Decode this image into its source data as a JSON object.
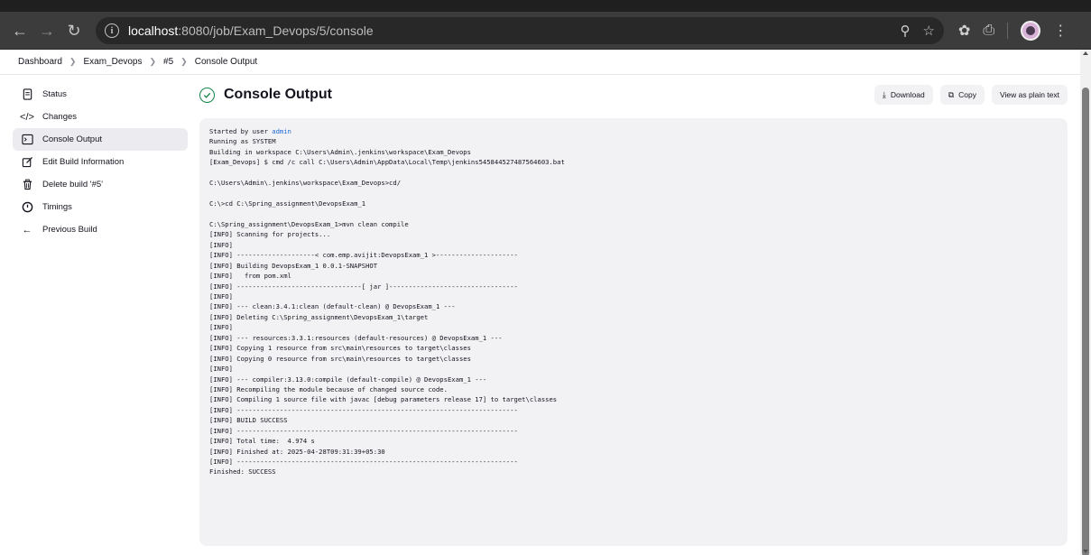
{
  "browser": {
    "url_host": "localhost",
    "url_rest": ":8080/job/Exam_Devops/5/console"
  },
  "breadcrumb": [
    "Dashboard",
    "Exam_Devops",
    "#5",
    "Console Output"
  ],
  "sidebar": {
    "items": [
      {
        "label": "Status",
        "icon": "document-icon",
        "active": false
      },
      {
        "label": "Changes",
        "icon": "code-icon",
        "active": false
      },
      {
        "label": "Console Output",
        "icon": "terminal-icon",
        "active": true
      },
      {
        "label": "Edit Build Information",
        "icon": "edit-icon",
        "active": false
      },
      {
        "label": "Delete build '#5'",
        "icon": "trash-icon",
        "active": false
      },
      {
        "label": "Timings",
        "icon": "clock-icon",
        "active": false
      },
      {
        "label": "Previous Build",
        "icon": "arrow-left-icon",
        "active": false
      }
    ]
  },
  "main": {
    "title": "Console Output",
    "status_color": "#138347",
    "actions": {
      "download": "Download",
      "copy": "Copy",
      "plain": "View as plain text"
    }
  },
  "console": {
    "started_prefix": "Started by user ",
    "started_user": "admin",
    "lines": [
      "Running as SYSTEM",
      "Building in workspace C:\\Users\\Admin\\.jenkins\\workspace\\Exam_Devops",
      "[Exam_Devops] $ cmd /c call C:\\Users\\Admin\\AppData\\Local\\Temp\\jenkins545844527487564603.bat",
      "",
      "C:\\Users\\Admin\\.jenkins\\workspace\\Exam_Devops>cd/",
      "",
      "C:\\>cd C:\\Spring_assignment\\DevopsExam_1",
      "",
      "C:\\Spring_assignment\\DevopsExam_1>mvn clean compile",
      "[INFO] Scanning for projects...",
      "[INFO]",
      "[INFO] --------------------< com.emp.avijit:DevopsExam_1 >---------------------",
      "[INFO] Building DevopsExam_1 0.0.1-SNAPSHOT",
      "[INFO]   from pom.xml",
      "[INFO] --------------------------------[ jar ]---------------------------------",
      "[INFO]",
      "[INFO] --- clean:3.4.1:clean (default-clean) @ DevopsExam_1 ---",
      "[INFO] Deleting C:\\Spring_assignment\\DevopsExam_1\\target",
      "[INFO]",
      "[INFO] --- resources:3.3.1:resources (default-resources) @ DevopsExam_1 ---",
      "[INFO] Copying 1 resource from src\\main\\resources to target\\classes",
      "[INFO] Copying 0 resource from src\\main\\resources to target\\classes",
      "[INFO]",
      "[INFO] --- compiler:3.13.0:compile (default-compile) @ DevopsExam_1 ---",
      "[INFO] Recompiling the module because of changed source code.",
      "[INFO] Compiling 1 source file with javac [debug parameters release 17] to target\\classes",
      "[INFO] ------------------------------------------------------------------------",
      "[INFO] BUILD SUCCESS",
      "[INFO] ------------------------------------------------------------------------",
      "[INFO] Total time:  4.974 s",
      "[INFO] Finished at: 2025-04-28T09:31:39+05:30",
      "[INFO] ------------------------------------------------------------------------",
      "Finished: SUCCESS"
    ]
  }
}
